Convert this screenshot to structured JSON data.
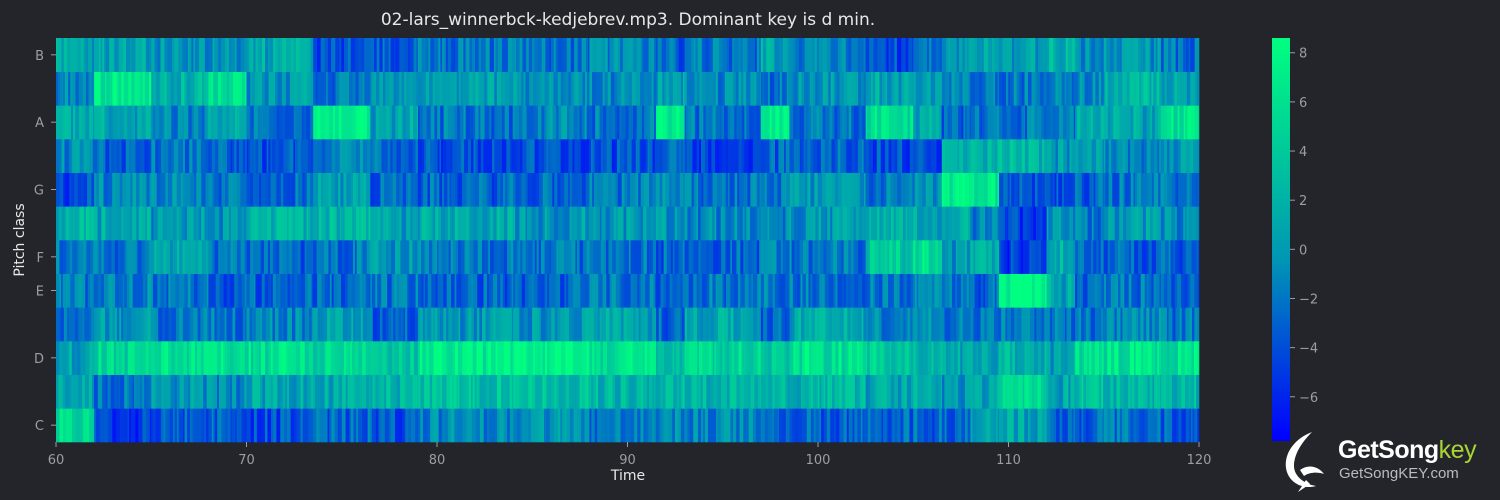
{
  "chart_data": {
    "type": "heatmap",
    "title": "02-lars_winnerbck-kedjebrev.mp3. Dominant key is d min.",
    "xlabel": "Time",
    "ylabel": "Pitch class",
    "xlim": [
      60,
      120
    ],
    "x_ticks": [
      "60",
      "70",
      "80",
      "90",
      "100",
      "110",
      "120"
    ],
    "rows": [
      "C",
      "C#",
      "D",
      "D#",
      "E",
      "F",
      "F#",
      "G",
      "G#",
      "A",
      "A#",
      "B"
    ],
    "y_ticks": [
      "C",
      "D",
      "E",
      "F",
      "G",
      "A",
      "B"
    ],
    "colorbar": {
      "min": -7.8,
      "max": 8.6,
      "ticks": [
        "8",
        "6",
        "4",
        "2",
        "0",
        "−2",
        "−4",
        "−6"
      ]
    },
    "colormap": [
      "#0000ff",
      "#0096b4",
      "#00ff80"
    ],
    "segments": [
      {
        "x0": 60,
        "x1": 62,
        "v": [
          5,
          1,
          1,
          -3,
          -2,
          -2,
          2,
          -4,
          -1,
          1,
          -1,
          1
        ]
      },
      {
        "x0": 62,
        "x1": 65,
        "v": [
          -5,
          -2,
          5,
          0,
          -1,
          -2,
          1,
          -1,
          -3,
          1,
          7,
          1
        ]
      },
      {
        "x0": 65,
        "x1": 68,
        "v": [
          -3,
          0,
          6,
          -2,
          -2,
          1,
          0,
          -1,
          -2,
          -1,
          2,
          0
        ]
      },
      {
        "x0": 68,
        "x1": 70,
        "v": [
          -3,
          -1,
          6,
          -2,
          -3,
          -2,
          0,
          -2,
          -3,
          2,
          6,
          0
        ]
      },
      {
        "x0": 70,
        "x1": 73.5,
        "v": [
          -4,
          1,
          6,
          -1,
          -3,
          -3,
          2,
          -3,
          -4,
          -2,
          0,
          1
        ]
      },
      {
        "x0": 73.5,
        "x1": 76.5,
        "v": [
          -3,
          1,
          5,
          1,
          -3,
          -2,
          2,
          0,
          -1,
          8,
          -2,
          -4
        ]
      },
      {
        "x0": 76.5,
        "x1": 79,
        "v": [
          -4,
          2,
          4,
          -3,
          -2,
          0,
          0,
          -3,
          -2,
          1,
          -1,
          -3
        ]
      },
      {
        "x0": 79,
        "x1": 84,
        "v": [
          -1,
          3,
          7,
          0,
          -3,
          -2,
          1,
          -3,
          -4,
          -2,
          0,
          -2
        ]
      },
      {
        "x0": 84,
        "x1": 88,
        "v": [
          0,
          3,
          8,
          0,
          -3,
          -2,
          0,
          -3,
          -4,
          -1,
          0,
          -2
        ]
      },
      {
        "x0": 88,
        "x1": 91.5,
        "v": [
          -2,
          2,
          6,
          1,
          -2,
          -2,
          0,
          -2,
          -4,
          -2,
          -1,
          -1
        ]
      },
      {
        "x0": 91.5,
        "x1": 93,
        "v": [
          -1,
          3,
          3,
          -3,
          -3,
          -3,
          0,
          -1,
          -2,
          7,
          0,
          -3
        ]
      },
      {
        "x0": 93,
        "x1": 97,
        "v": [
          -1,
          2,
          5,
          1,
          -2,
          -3,
          -1,
          -2,
          -5,
          -2,
          -1,
          -2
        ]
      },
      {
        "x0": 97,
        "x1": 98.5,
        "v": [
          -3,
          2,
          3,
          -3,
          -2,
          -1,
          -1,
          -2,
          -3,
          8,
          -2,
          1
        ]
      },
      {
        "x0": 98.5,
        "x1": 102.5,
        "v": [
          -3,
          2,
          6,
          1,
          -2,
          -2,
          0,
          0,
          -3,
          -2,
          0,
          -1
        ]
      },
      {
        "x0": 102.5,
        "x1": 105,
        "v": [
          -3,
          1,
          4,
          -1,
          -2,
          4,
          2,
          -2,
          -4,
          6,
          1,
          -4
        ]
      },
      {
        "x0": 105,
        "x1": 106.5,
        "v": [
          -3,
          2,
          2,
          0,
          0,
          6,
          1,
          -1,
          -4,
          1,
          0,
          -2
        ]
      },
      {
        "x0": 106.5,
        "x1": 108,
        "v": [
          -3,
          0,
          1,
          -2,
          -2,
          0,
          1,
          7,
          2,
          -3,
          -1,
          0
        ]
      },
      {
        "x0": 108,
        "x1": 109.5,
        "v": [
          0,
          1,
          0,
          -2,
          -3,
          1,
          -1,
          7,
          2,
          -2,
          -2,
          1
        ]
      },
      {
        "x0": 109.5,
        "x1": 112,
        "v": [
          1,
          6,
          2,
          -2,
          8,
          -5,
          -5,
          -4,
          2,
          -2,
          -2,
          0
        ]
      },
      {
        "x0": 112,
        "x1": 113.5,
        "v": [
          -3,
          1,
          0,
          -2,
          1,
          2,
          0,
          -4,
          0,
          -2,
          -1,
          2
        ]
      },
      {
        "x0": 113.5,
        "x1": 115,
        "v": [
          -3,
          3,
          6,
          -2,
          -3,
          -2,
          -2,
          -3,
          0,
          2,
          -1,
          -1
        ]
      },
      {
        "x0": 115,
        "x1": 118,
        "v": [
          -2,
          2,
          6,
          -1,
          -2,
          -3,
          0,
          -2,
          -1,
          1,
          2,
          0
        ]
      },
      {
        "x0": 118,
        "x1": 120,
        "v": [
          -3,
          2,
          6,
          -2,
          -3,
          -3,
          -1,
          -2,
          0,
          6,
          1,
          -2
        ]
      }
    ]
  },
  "watermark": {
    "brand_main": "GetSong",
    "brand_accent": "key",
    "url": "GetSongKEY.com"
  }
}
